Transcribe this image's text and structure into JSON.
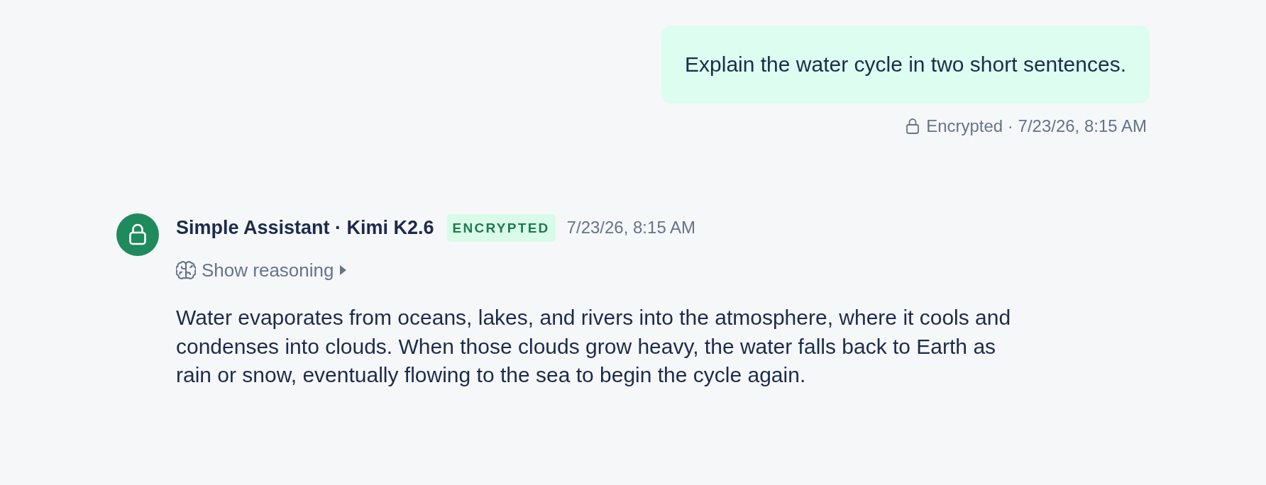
{
  "messages": [
    {
      "kind": "user",
      "text": "Explain the water cycle in two short sentences.",
      "status": "Encrypted · 7/23/26, 8:15 AM"
    },
    {
      "kind": "assistant",
      "sender": "Simple Assistant · Kimi K2.6",
      "badge": "ENCRYPTED",
      "timestamp": "7/23/26, 8:15 AM",
      "reasoning": {
        "label": "Show reasoning",
        "expanded": false
      },
      "text": "Water evaporates from oceans, lakes, and rivers into the atmosphere, where it cools and condenses into clouds. When those clouds grow heavy, the water falls back to Earth as rain or snow, eventually flowing to the sea to begin the cycle again."
    }
  ]
}
